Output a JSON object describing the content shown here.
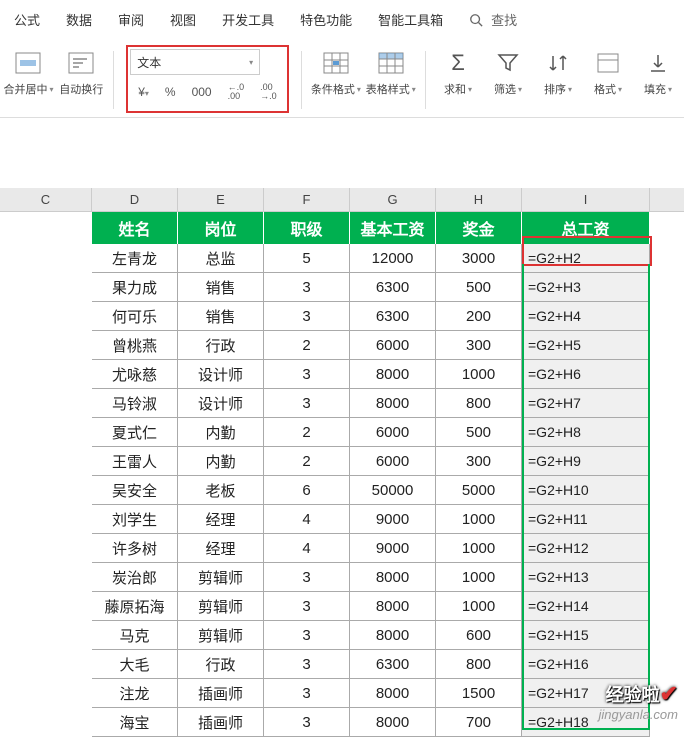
{
  "menu": {
    "items": [
      "公式",
      "数据",
      "审阅",
      "视图",
      "开发工具",
      "特色功能",
      "智能工具箱"
    ],
    "search": "查找"
  },
  "toolbar": {
    "merge_center": "合并居中",
    "auto_wrap": "自动换行",
    "number_format": "文本",
    "cond_format": "条件格式",
    "table_style": "表格样式",
    "sum": "求和",
    "filter": "筛选",
    "sort": "排序",
    "format": "格式",
    "fill": "填充",
    "currency": "¥",
    "percent": "%",
    "comma": "000",
    "dec_inc": "+.0",
    "dec_dec": ".00",
    "dec_inc2": ".00",
    "dec_dec2": "→.0"
  },
  "columns": {
    "C": "C",
    "D": "D",
    "E": "E",
    "F": "F",
    "G": "G",
    "H": "H",
    "I": "I"
  },
  "headers": {
    "name": "姓名",
    "position": "岗位",
    "rank": "职级",
    "base_salary": "基本工资",
    "bonus": "奖金",
    "total": "总工资"
  },
  "chart_data": {
    "type": "table",
    "columns": [
      "姓名",
      "岗位",
      "职级",
      "基本工资",
      "奖金",
      "总工资"
    ],
    "rows": [
      {
        "name": "左青龙",
        "pos": "总监",
        "rank": "5",
        "base": "12000",
        "bonus": "3000",
        "formula": "=G2+H2"
      },
      {
        "name": "果力成",
        "pos": "销售",
        "rank": "3",
        "base": "6300",
        "bonus": "500",
        "formula": "=G2+H3"
      },
      {
        "name": "何可乐",
        "pos": "销售",
        "rank": "3",
        "base": "6300",
        "bonus": "200",
        "formula": "=G2+H4"
      },
      {
        "name": "曾桃燕",
        "pos": "行政",
        "rank": "2",
        "base": "6000",
        "bonus": "300",
        "formula": "=G2+H5"
      },
      {
        "name": "尤咏慈",
        "pos": "设计师",
        "rank": "3",
        "base": "8000",
        "bonus": "1000",
        "formula": "=G2+H6"
      },
      {
        "name": "马铃淑",
        "pos": "设计师",
        "rank": "3",
        "base": "8000",
        "bonus": "800",
        "formula": "=G2+H7"
      },
      {
        "name": "夏式仁",
        "pos": "内勤",
        "rank": "2",
        "base": "6000",
        "bonus": "500",
        "formula": "=G2+H8"
      },
      {
        "name": "王雷人",
        "pos": "内勤",
        "rank": "2",
        "base": "6000",
        "bonus": "300",
        "formula": "=G2+H9"
      },
      {
        "name": "吴安全",
        "pos": "老板",
        "rank": "6",
        "base": "50000",
        "bonus": "5000",
        "formula": "=G2+H10"
      },
      {
        "name": "刘学生",
        "pos": "经理",
        "rank": "4",
        "base": "9000",
        "bonus": "1000",
        "formula": "=G2+H11"
      },
      {
        "name": "许多树",
        "pos": "经理",
        "rank": "4",
        "base": "9000",
        "bonus": "1000",
        "formula": "=G2+H12"
      },
      {
        "name": "炭治郎",
        "pos": "剪辑师",
        "rank": "3",
        "base": "8000",
        "bonus": "1000",
        "formula": "=G2+H13"
      },
      {
        "name": "藤原拓海",
        "pos": "剪辑师",
        "rank": "3",
        "base": "8000",
        "bonus": "1000",
        "formula": "=G2+H14"
      },
      {
        "name": "马克",
        "pos": "剪辑师",
        "rank": "3",
        "base": "8000",
        "bonus": "600",
        "formula": "=G2+H15"
      },
      {
        "name": "大毛",
        "pos": "行政",
        "rank": "3",
        "base": "6300",
        "bonus": "800",
        "formula": "=G2+H16"
      },
      {
        "name": "注龙",
        "pos": "插画师",
        "rank": "3",
        "base": "8000",
        "bonus": "1500",
        "formula": "=G2+H17"
      },
      {
        "name": "海宝",
        "pos": "插画师",
        "rank": "3",
        "base": "8000",
        "bonus": "700",
        "formula": "=G2+H18"
      }
    ]
  },
  "watermark": {
    "line1": "经验啦",
    "line2": "jingyanla.com"
  }
}
